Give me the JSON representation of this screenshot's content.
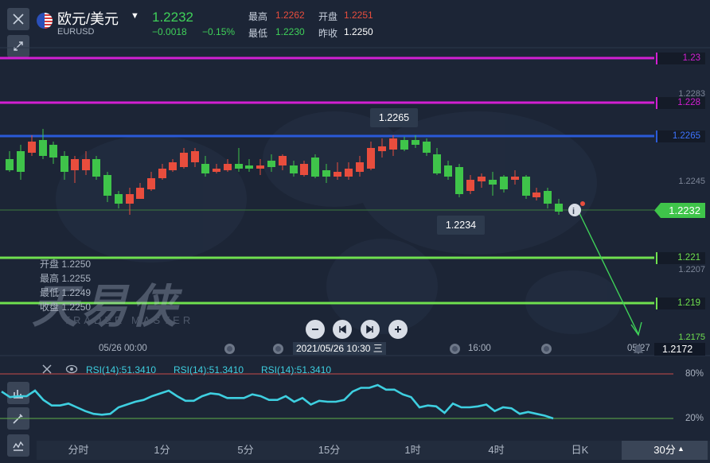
{
  "header": {
    "pair_name": "欧元/美元",
    "pair_code": "EURUSD",
    "price": "1.2232",
    "change": "−0.0018",
    "change_pct": "−0.15%",
    "high_label": "最高",
    "high_value": "1.2262",
    "open_label": "开盘",
    "open_value": "1.2251",
    "low_label": "最低",
    "low_value": "1.2230",
    "prev_close_label": "昨收",
    "prev_close_value": "1.2250"
  },
  "price_lines": [
    {
      "label": "1.23",
      "color": "#d21fd3"
    },
    {
      "label": "1.228",
      "color": "#d21fd3"
    },
    {
      "label": "1.2265",
      "color": "#2a5ad8"
    },
    {
      "label": "1.221",
      "color": "#6fe04f"
    },
    {
      "label": "1.219",
      "color": "#6fe04f"
    }
  ],
  "axis_ticks": [
    "1.2283",
    "1.2245",
    "1.2207",
    "1.2175"
  ],
  "current_price": "1.2232",
  "tooltips": {
    "high": "1.2265",
    "low": "1.2234"
  },
  "ohlc_overlay": {
    "open": "开盘 1.2250",
    "high": "最高 1.2255",
    "low": "最低 1.2249",
    "close": "收盘 1.2250"
  },
  "watermark": {
    "main": "天易侠",
    "sub": "TRADER MASTER"
  },
  "time_axis": {
    "left_label": "05/26 00:00",
    "cursor_label": "2021/05/26 10:30 三",
    "mid_label": "16:00",
    "right_label": "05/27",
    "bottom_price": "1.2172"
  },
  "indicator": {
    "labels": [
      "RSI(14):51.3410",
      "RSI(14):51.3410",
      "RSI(14):51.3410"
    ],
    "upper": "80%",
    "lower": "20%",
    "values": [
      61,
      55,
      56,
      56,
      62,
      52,
      46,
      46,
      48,
      44,
      40,
      37,
      36,
      37,
      44,
      47,
      50,
      52,
      56,
      59,
      62,
      56,
      51,
      51,
      56,
      59,
      58,
      54,
      54,
      54,
      58,
      56,
      52,
      52,
      56,
      50,
      54,
      47,
      51,
      50,
      50,
      52,
      61,
      65,
      65,
      68,
      63,
      63,
      58,
      55,
      44,
      46,
      45,
      38,
      48,
      44,
      44,
      45,
      47,
      40,
      44,
      43,
      37,
      39,
      37,
      35,
      32
    ]
  },
  "tabs": [
    "分时",
    "1分",
    "5分",
    "15分",
    "1时",
    "4时",
    "日K",
    "30分"
  ],
  "active_tab": "30分",
  "colors": {
    "up": "#e84d3d",
    "down": "#3fc44a",
    "accent": "#3fc44a",
    "rsi": "#3ecfe0"
  },
  "icons": [
    "close-icon",
    "shrink-icon",
    "bar-chart-icon",
    "pencil-icon",
    "line-indicator-icon",
    "zoom-out-icon",
    "prev-icon",
    "next-icon",
    "zoom-in-icon",
    "eye-icon",
    "bell-icon",
    "info-icon"
  ]
}
